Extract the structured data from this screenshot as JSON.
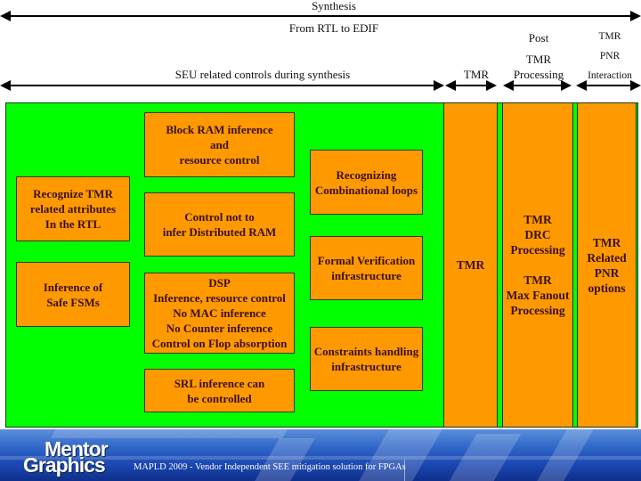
{
  "header": {
    "synthesis_label": "Synthesis",
    "from_rtl_label": "From RTL to EDIF",
    "seu_label": "SEU related controls during synthesis",
    "tmr_label": "TMR",
    "post_tmr_label_line1": "Post",
    "post_tmr_label_line2": "TMR",
    "post_tmr_label_line3": "Processing",
    "pnr_label_line1": "TMR",
    "pnr_label_line2": "PNR",
    "pnr_label_line3": "Interaction"
  },
  "synthesis_boxes": {
    "recognize_tmr": "Recognize TMR\nrelated attributes\nIn the RTL",
    "safe_fsms": "Inference of\nSafe FSMs",
    "block_ram": "Block RAM inference\nand\nresource control",
    "distributed_ram": "Control not to\ninfer Distributed RAM",
    "dsp": "DSP\nInference, resource control\nNo MAC inference\nNo Counter inference\nControl on Flop absorption",
    "srl": "SRL inference can\nbe controlled",
    "combinational_loops": "Recognizing\nCombinational loops",
    "formal_verification": "Formal Verification\ninfrastructure",
    "constraints": "Constraints handling\ninfrastructure"
  },
  "columns": {
    "tmr": "TMR",
    "post_tmr": "TMR\nDRC\nProcessing\n\nTMR\nMax Fanout\nProcessing",
    "pnr": "TMR\nRelated\nPNR\noptions"
  },
  "footer": {
    "logo_line1": "Mentor",
    "logo_line2": "Graphics",
    "caption": "MAPLD 2009 - Vendor Independent SEE mitigation solution for FPGAs"
  },
  "colors": {
    "panel_green": "#00ff00",
    "box_orange": "#ff9900",
    "footer_blue": "#1a46b0"
  }
}
